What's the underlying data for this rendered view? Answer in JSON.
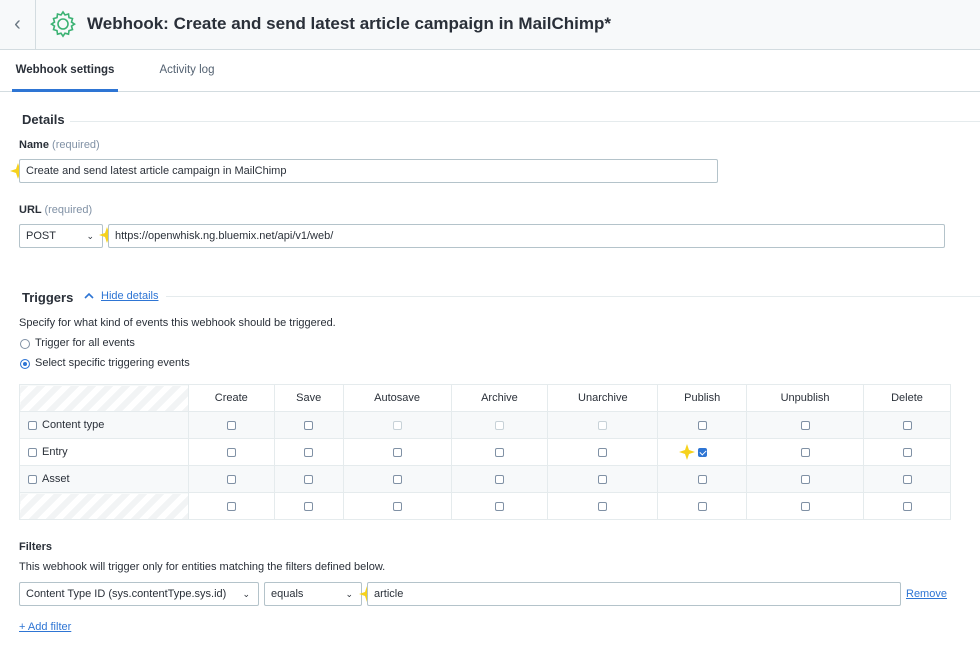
{
  "header": {
    "title": "Webhook: Create and send latest article campaign in MailChimp*",
    "back_icon": "chevron-left-icon",
    "app_icon": "gear-icon",
    "accent_color": "#3bb273"
  },
  "tabs": [
    {
      "label": "Webhook settings",
      "active": true
    },
    {
      "label": "Activity log",
      "active": false
    }
  ],
  "details": {
    "heading": "Details",
    "name_label": "Name",
    "name_req": "(required)",
    "name_value": "Create and send latest article campaign in MailChimp",
    "url_label": "URL",
    "url_req": "(required)",
    "method": "POST",
    "url_value": "https://openwhisk.ng.bluemix.net/api/v1/web/"
  },
  "triggers": {
    "heading": "Triggers",
    "toggle_link": "Hide details",
    "description": "Specify for what kind of events this webhook should be triggered.",
    "options": [
      {
        "label": "Trigger for all events",
        "selected": false
      },
      {
        "label": "Select specific triggering events",
        "selected": true
      }
    ],
    "columns": [
      "Create",
      "Save",
      "Autosave",
      "Archive",
      "Unarchive",
      "Publish",
      "Unpublish",
      "Delete"
    ],
    "rows": [
      {
        "label": "Content type",
        "cells": [
          "off",
          "off",
          "disabled",
          "disabled",
          "disabled",
          "off",
          "off",
          "off"
        ]
      },
      {
        "label": "Entry",
        "cells": [
          "off",
          "off",
          "off",
          "off",
          "off",
          "on",
          "off",
          "off"
        ]
      },
      {
        "label": "Asset",
        "cells": [
          "off",
          "off",
          "off",
          "off",
          "off",
          "off",
          "off",
          "off"
        ]
      },
      {
        "label": "",
        "cells": [
          "off",
          "off",
          "off",
          "off",
          "off",
          "off",
          "off",
          "off"
        ]
      }
    ]
  },
  "filters": {
    "heading": "Filters",
    "description": "This webhook will trigger only for entities matching the filters defined below.",
    "field": "Content Type ID (sys.contentType.sys.id)",
    "operator": "equals",
    "value": "article",
    "remove_label": "Remove",
    "add_label": "+ Add filter"
  }
}
